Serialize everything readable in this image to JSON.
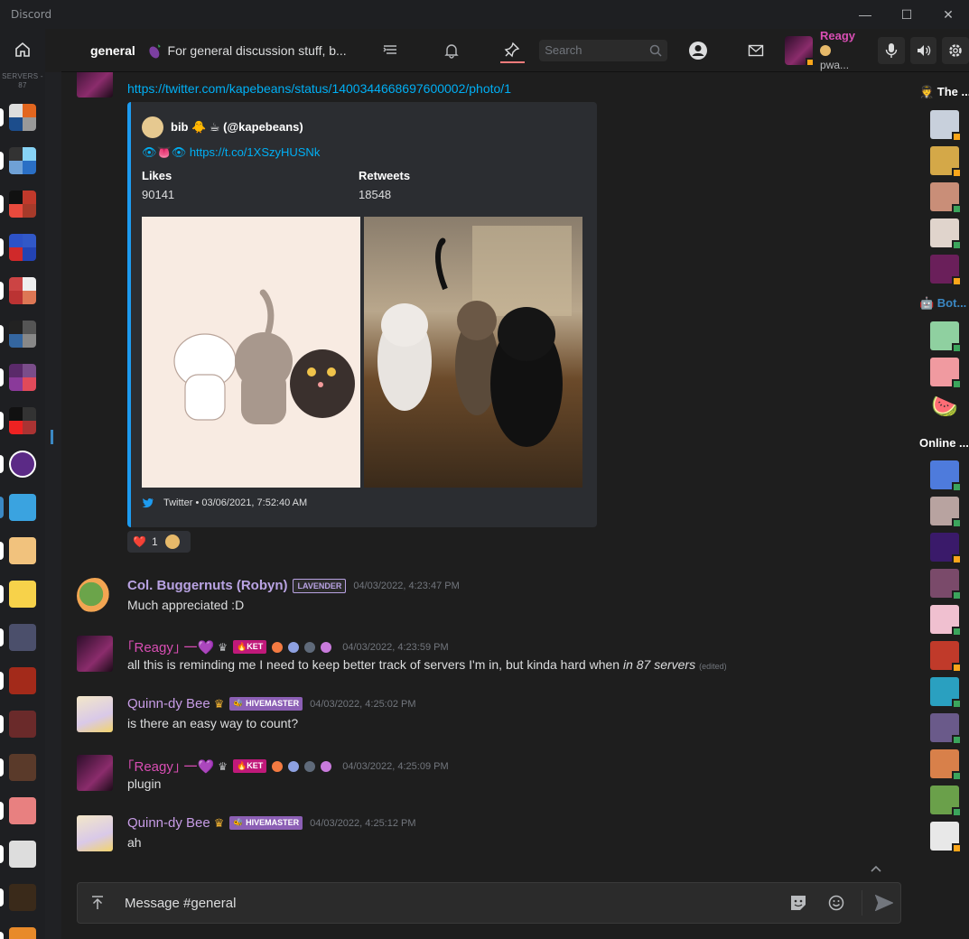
{
  "window": {
    "title": "Discord",
    "minimize": "—",
    "maximize": "☐",
    "close": "✕"
  },
  "servers": {
    "count_label": "SERVERS - 87"
  },
  "header": {
    "channel": "general",
    "topic": "For general discussion stuff, b...",
    "search_placeholder": "Search"
  },
  "user": {
    "name": "Reagy",
    "status": "pwa..."
  },
  "embed": {
    "link": "https://twitter.com/kapebeans/status/1400344668697600002/photo/1",
    "author": "bib 🐥 ☕ (@kapebeans)",
    "desc_emoji": "👁👅👁",
    "desc_link": "https://t.co/1XSzyHUSNk",
    "field1_name": "Likes",
    "field1_value": "90141",
    "field2_name": "Retweets",
    "field2_value": "18548",
    "footer": "Twitter • 03/06/2021, 7:52:40 AM"
  },
  "reaction": {
    "emoji": "❤️",
    "count": "1"
  },
  "messages": [
    {
      "author": "Col. Buggernuts (Robyn)",
      "role": "LAVENDER",
      "timestamp": "04/03/2022, 4:23:47 PM",
      "text": "Much appreciated :D"
    },
    {
      "author": "｢Reagy｣ 一💜",
      "role": "🔥KET",
      "timestamp": "04/03/2022, 4:23:59 PM",
      "text": "all this is reminding me I need to keep better track of servers I'm in, but kinda hard when ",
      "emph": "in 87 servers",
      "edited": "(edited)"
    },
    {
      "author": "Quinn-dy Bee",
      "role": "🐝 HIVEMASTER",
      "timestamp": "04/03/2022, 4:25:02 PM",
      "text": "is there an easy way to count?"
    },
    {
      "author": "｢Reagy｣ 一💜",
      "role": "🔥KET",
      "timestamp": "04/03/2022, 4:25:09 PM",
      "text": "plugin"
    },
    {
      "author": "Quinn-dy Bee",
      "role": "🐝 HIVEMASTER",
      "timestamp": "04/03/2022, 4:25:12 PM",
      "text": "ah"
    }
  ],
  "members": {
    "cat1": "🧑‍✈️ The ...",
    "cat2": "🤖 Bot...",
    "cat3": "Online ..."
  },
  "composer": {
    "placeholder": "Message #general"
  },
  "colors": {
    "accent": "#1d9bf0",
    "reagy": "#d94eb4",
    "lavender": "#b9a3e3",
    "bee": "#c79ce6",
    "online": "#3ba55c",
    "idle": "#faa61a"
  }
}
